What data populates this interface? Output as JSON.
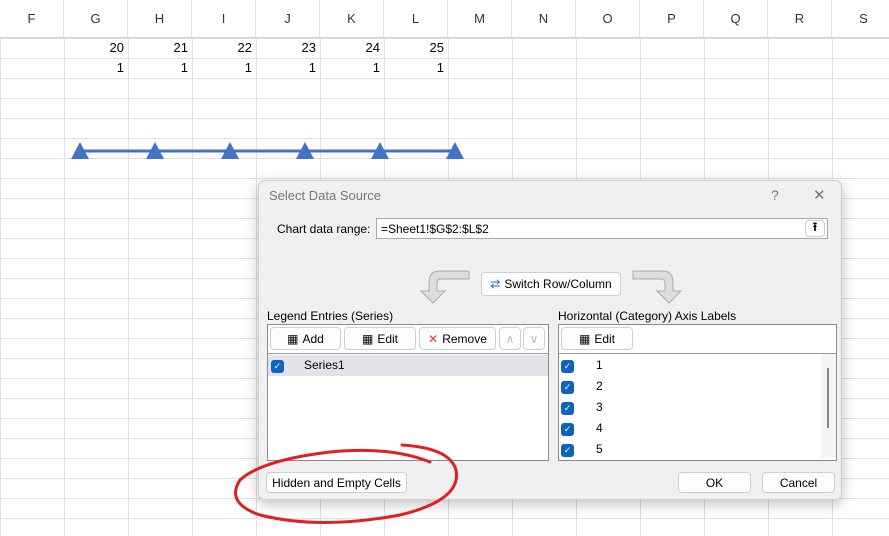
{
  "columns": [
    "F",
    "G",
    "H",
    "I",
    "J",
    "K",
    "L",
    "M",
    "N",
    "O",
    "P",
    "Q",
    "R",
    "S"
  ],
  "row1": [
    "20",
    "21",
    "22",
    "23",
    "24",
    "25"
  ],
  "row2": [
    "1",
    "1",
    "1",
    "1",
    "1",
    "1"
  ],
  "chart": {
    "series_color": "#4472c4",
    "marker": "triangle",
    "points": 6
  },
  "dialog": {
    "title": "Select Data Source",
    "help": "?",
    "close": "✕",
    "range_label": "Chart data range:",
    "range_value": "=Sheet1!$G$2:$L$2",
    "switch": "Switch Row/Column",
    "legend_title": "Legend Entries (Series)",
    "add": "Add",
    "edit": "Edit",
    "remove": "Remove",
    "series": [
      "Series1"
    ],
    "axis_title": "Horizontal (Category) Axis Labels",
    "axis_edit": "Edit",
    "axis_labels": [
      "1",
      "2",
      "3",
      "4",
      "5"
    ],
    "hidden": "Hidden and Empty Cells",
    "ok": "OK",
    "cancel": "Cancel"
  },
  "annotation_color": "#e02020"
}
